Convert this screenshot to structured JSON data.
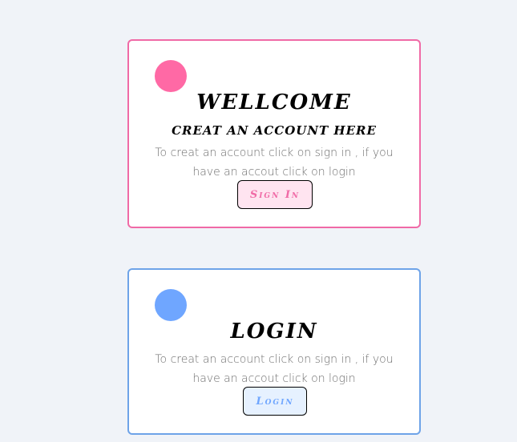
{
  "signup_card": {
    "title": "WELLCOME",
    "subtitle": "CREAT AN ACCOUNT HERE",
    "description": "To creat an account click on sign in , if you have an accout click on login",
    "button_label": "Sign In",
    "accent_color": "#f06aa6"
  },
  "login_card": {
    "title": "LOGIN",
    "description": "To creat an account click on sign in , if you have an accout click on login",
    "button_label": "Login",
    "accent_color": "#6ea3e8"
  }
}
